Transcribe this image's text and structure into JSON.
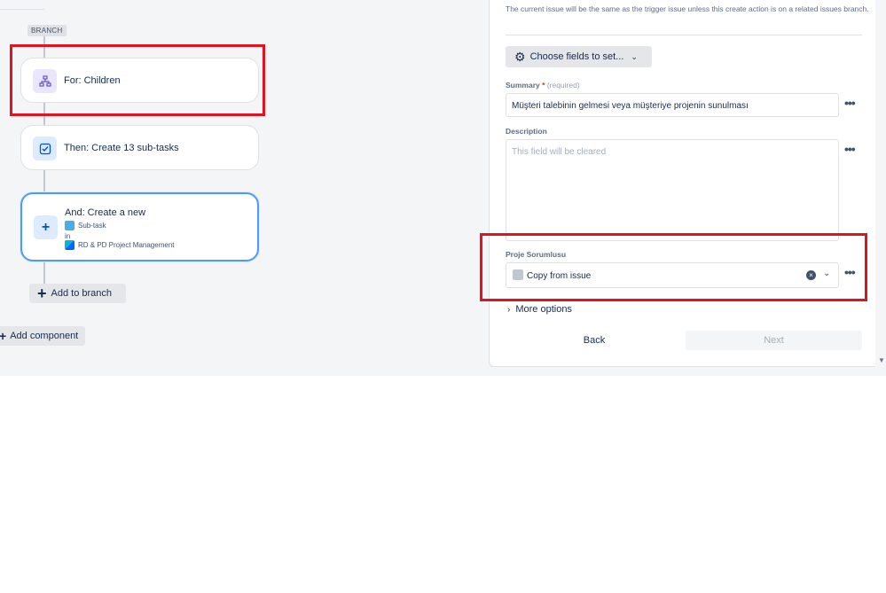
{
  "canvas": {
    "branch_tag": "BRANCH",
    "for_card": {
      "title": "For: Children",
      "icon": "hierarchy-icon"
    },
    "then_card": {
      "title": "Then: Create 13 sub-tasks",
      "icon": "checkbox-icon"
    },
    "and_card": {
      "title": "And: Create a new",
      "issue_type": "Sub-task",
      "in_label": "in",
      "project": "RD & PD Project Management",
      "icon": "plus-icon"
    },
    "add_to_branch": "Add to branch",
    "add_component": "Add component"
  },
  "panel": {
    "info_text": "The current issue will be the same as the trigger issue unless this create action is on a related issues branch.",
    "choose_fields": "Choose fields to set...",
    "summary": {
      "label": "Summary",
      "required_mark": "*",
      "required_hint": "(required)",
      "value": "Müşteri talebinin gelmesi veya müşteriye projenin sunulması"
    },
    "description": {
      "label": "Description",
      "placeholder": "This field will be cleared"
    },
    "proje": {
      "label": "Proje Sorumlusu",
      "value": "Copy from issue"
    },
    "more_options": "More options",
    "back": "Back",
    "next": "Next"
  },
  "colors": {
    "highlight": "#e0141e",
    "selected_border": "#4c9aff",
    "canvas_bg": "#f4f5f7"
  }
}
